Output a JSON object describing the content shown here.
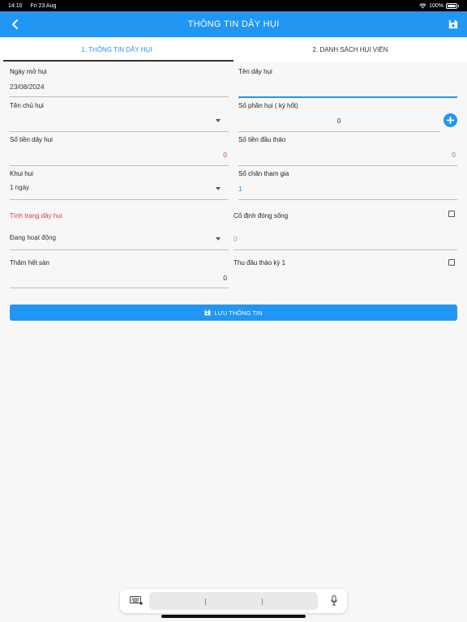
{
  "status": {
    "time": "14:10",
    "date": "Fri 23 Aug",
    "battery": "100%"
  },
  "appbar": {
    "title": "THÔNG TIN DÂY HỤI"
  },
  "tabs": [
    {
      "label": "1. THÔNG TIN DÂY HỤI",
      "active": true
    },
    {
      "label": "2. DANH SÁCH HỤI VIÊN",
      "active": false
    }
  ],
  "form": {
    "ngay_mo_hui": {
      "label": "Ngày mở hụi",
      "value": "23/08/2024"
    },
    "ten_day_hui": {
      "label": "Tên dây hụi",
      "value": ""
    },
    "ten_chu_hui": {
      "label": "Tên chủ hụi",
      "value": ""
    },
    "so_phan_hui": {
      "label": "Số phần hụi ( ký hốt)",
      "value": "0"
    },
    "so_tien_day_hui": {
      "label": "Số tiền dây hụi",
      "value": "0"
    },
    "so_tien_dau_thao": {
      "label": "Số tiền đầu thảo",
      "value": "0"
    },
    "khui_hui": {
      "label": "Khui hụi",
      "value": "1 ngày"
    },
    "so_chan_tham_gia": {
      "label": "Số chân tham gia",
      "value": "1"
    },
    "tinh_trang": {
      "label": "Tình trạng dây hụi",
      "value": "Đang hoạt động"
    },
    "co_dinh_dong_song": {
      "label": "Cố định đóng sống",
      "value": "0",
      "checked": false
    },
    "tham_het_san": {
      "label": "Thăm hết sàn",
      "value": "0"
    },
    "thu_dau_thao_ky1": {
      "label": "Thu đầu thảo kỳ 1",
      "checked": false
    }
  },
  "save_button": {
    "label": "LƯU THÔNG TIN"
  },
  "colors": {
    "primary": "#2196f3",
    "red": "#e53935",
    "green": "#4caf50"
  }
}
